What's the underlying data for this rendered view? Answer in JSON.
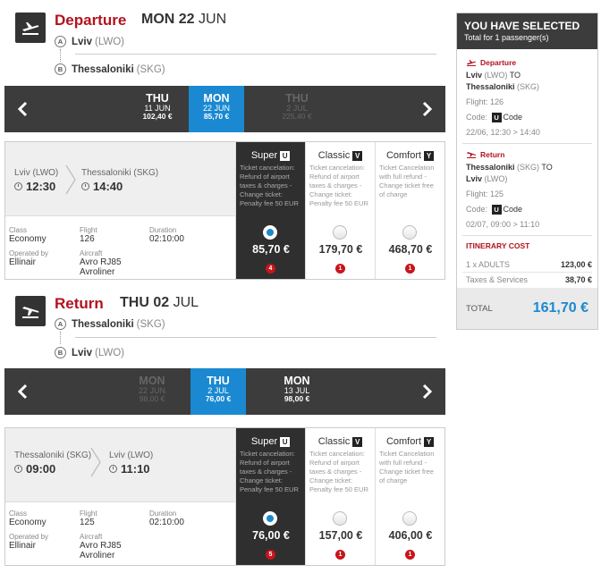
{
  "departure": {
    "direction": "Departure",
    "date_bold": "MON 22",
    "date_month": "JUN",
    "origin": {
      "letter": "A",
      "city": "Lviv",
      "code": "(LWO)"
    },
    "destination": {
      "letter": "B",
      "city": "Thessaloniki",
      "code": "(SKG)"
    },
    "dates": [
      {
        "day": "THU",
        "date": "11 JUN",
        "price": "102,40 €",
        "state": "normal"
      },
      {
        "day": "MON",
        "date": "22 JUN",
        "price": "85,70 €",
        "state": "selected"
      },
      {
        "day": "THU",
        "date": "2 JUL",
        "price": "225,40 €",
        "state": "dim"
      }
    ],
    "flight": {
      "from_label": "Lviv (LWO)",
      "from_time": "12:30",
      "to_label": "Thessaloniki (SKG)",
      "to_time": "14:40",
      "class_label": "Class",
      "class_value": "Economy",
      "flight_label": "Flight",
      "flight_value": "126",
      "duration_label": "Duration",
      "duration_value": "02:10:00",
      "operated_label": "Operated by",
      "operated_value": "Ellinair",
      "aircraft_label": "Aircraft",
      "aircraft_value": "Avro RJ85 Avroliner"
    },
    "fares": [
      {
        "name": "Super",
        "code": "U",
        "desc": "Ticket cancelation: Refund of airport taxes & charges - Change ticket: Penalty fee 50 EUR",
        "price": "85,70 €",
        "seats": "4",
        "selected": true
      },
      {
        "name": "Classic",
        "code": "V",
        "desc": "Ticket cancelation: Refund of airport taxes & charges - Change ticket: Penalty fee 50 EUR",
        "price": "179,70 €",
        "seats": "1",
        "selected": false
      },
      {
        "name": "Comfort",
        "code": "Y",
        "desc": "Ticket Cancelation with full refund - Change ticket free of charge",
        "price": "468,70 €",
        "seats": "1",
        "selected": false
      }
    ]
  },
  "return": {
    "direction": "Return",
    "date_bold": "THU 02",
    "date_month": "JUL",
    "origin": {
      "letter": "A",
      "city": "Thessaloniki",
      "code": "(SKG)"
    },
    "destination": {
      "letter": "B",
      "city": "Lviv",
      "code": "(LWO)"
    },
    "dates": [
      {
        "day": "MON",
        "date": "22 JUN",
        "price": "98,00 €",
        "state": "dim"
      },
      {
        "day": "THU",
        "date": "2 JUL",
        "price": "76,00 €",
        "state": "selected"
      },
      {
        "day": "MON",
        "date": "13 JUL",
        "price": "98,00 €",
        "state": "normal"
      }
    ],
    "flight": {
      "from_label": "Thessaloniki (SKG)",
      "from_time": "09:00",
      "to_label": "Lviv (LWO)",
      "to_time": "11:10",
      "class_label": "Class",
      "class_value": "Economy",
      "flight_label": "Flight",
      "flight_value": "125",
      "duration_label": "Duration",
      "duration_value": "02:10:00",
      "operated_label": "Operated by",
      "operated_value": "Ellinair",
      "aircraft_label": "Aircraft",
      "aircraft_value": "Avro RJ85 Avroliner"
    },
    "fares": [
      {
        "name": "Super",
        "code": "U",
        "desc": "Ticket cancelation: Refund of airport taxes & charges - Change ticket: Penalty fee 50 EUR",
        "price": "76,00 €",
        "seats": "5",
        "selected": true
      },
      {
        "name": "Classic",
        "code": "V",
        "desc": "Ticket cancelation: Refund of airport taxes & charges - Change ticket: Penalty fee 50 EUR",
        "price": "157,00 €",
        "seats": "1",
        "selected": false
      },
      {
        "name": "Comfort",
        "code": "Y",
        "desc": "Ticket Cancelation with full refund - Change ticket free of charge",
        "price": "406,00 €",
        "seats": "1",
        "selected": false
      }
    ]
  },
  "summary": {
    "title": "YOU HAVE SELECTED",
    "subtitle": "Total for 1 passenger(s)",
    "departure": {
      "heading": "Departure",
      "from_city": "Lviv",
      "from_code": "(LWO)",
      "to_word": "TO",
      "to_city": "Thessaloniki",
      "to_code": "(SKG)",
      "flight_line": "Flight: 126",
      "code_label": "Code:",
      "code_value": "U",
      "code_suffix": "Code",
      "time_line": "22/06, 12:30 > 14:40"
    },
    "return": {
      "heading": "Return",
      "from_city": "Thessaloniki",
      "from_code": "(SKG)",
      "to_word": "TO",
      "to_city": "Lviv",
      "to_code": "(LWO)",
      "flight_line": "Flight: 125",
      "code_label": "Code:",
      "code_value": "U",
      "code_suffix": "Code",
      "time_line": "02/07, 09:00 > 11:10"
    },
    "cost_heading": "ITINERARY COST",
    "adults_label": "1 x ADULTS",
    "adults_value": "123,00 €",
    "taxes_label": "Taxes & Services",
    "taxes_value": "38,70 €",
    "total_label": "TOTAL",
    "total_value": "161,70 €"
  },
  "colors": {
    "accent": "#b3121e",
    "selected": "#1a89d1",
    "dark": "#3c3c3c"
  }
}
